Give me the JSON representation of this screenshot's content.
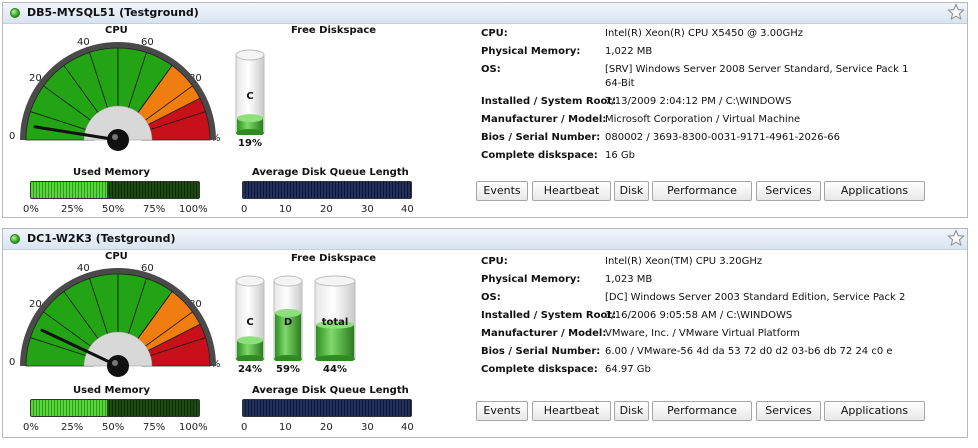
{
  "servers": [
    {
      "title": "DB5-MYSQL51 (Testground)",
      "cpu": {
        "label": "CPU",
        "percent": 5,
        "ticks": [
          "0",
          "20",
          "40",
          "60",
          "80",
          "%"
        ]
      },
      "diskspace": {
        "label": "Free Diskspace",
        "drives": [
          {
            "name": "C",
            "free_percent_label": "19%",
            "free_fraction": 0.19
          }
        ]
      },
      "used_memory": {
        "label": "Used Memory",
        "percent": 45,
        "ticks": [
          "0%",
          "25%",
          "50%",
          "75%",
          "100%"
        ]
      },
      "disk_queue": {
        "label": "Average Disk Queue Length",
        "value": 0,
        "max": 40,
        "ticks": [
          "0",
          "10",
          "20",
          "30",
          "40"
        ]
      },
      "info": [
        {
          "key": "CPU:",
          "value": "Intel(R) Xeon(R) CPU X5450 @ 3.00GHz"
        },
        {
          "key": "Physical Memory:",
          "value": "1,022 MB"
        },
        {
          "key": "OS:",
          "value": "[SRV] Windows Server 2008 Server Standard, Service Pack 1",
          "value2": "64-Bit"
        },
        {
          "key": "Installed / System Root:",
          "value": "7/13/2009 2:04:12 PM / C:\\WINDOWS"
        },
        {
          "key": "Manufacturer / Model:",
          "value": "Microsoft Corporation / Virtual Machine"
        },
        {
          "key": "Bios / Serial Number:",
          "value": "080002 / 3693-8300-0031-9171-4961-2026-66"
        },
        {
          "key": "Complete diskspace:",
          "value": "16 Gb"
        }
      ],
      "buttons": [
        "Events",
        "Heartbeat",
        "Disk",
        "Performance",
        "Services",
        "Applications"
      ]
    },
    {
      "title": "DC1-W2K3 (Testground)",
      "cpu": {
        "label": "CPU",
        "percent": 14,
        "ticks": [
          "0",
          "20",
          "40",
          "60",
          "80",
          "%"
        ]
      },
      "diskspace": {
        "label": "Free Diskspace",
        "drives": [
          {
            "name": "C",
            "free_percent_label": "24%",
            "free_fraction": 0.24
          },
          {
            "name": "D",
            "free_percent_label": "59%",
            "free_fraction": 0.59
          },
          {
            "name": "total",
            "free_percent_label": "44%",
            "free_fraction": 0.44
          }
        ]
      },
      "used_memory": {
        "label": "Used Memory",
        "percent": 45,
        "ticks": [
          "0%",
          "25%",
          "50%",
          "75%",
          "100%"
        ]
      },
      "disk_queue": {
        "label": "Average Disk Queue Length",
        "value": 0,
        "max": 40,
        "ticks": [
          "0",
          "10",
          "20",
          "30",
          "40"
        ]
      },
      "info": [
        {
          "key": "CPU:",
          "value": "Intel(R) Xeon(TM) CPU 3.20GHz"
        },
        {
          "key": "Physical Memory:",
          "value": "1,023 MB"
        },
        {
          "key": "OS:",
          "value": "[DC] Windows Server 2003 Standard Edition, Service Pack 2"
        },
        {
          "key": "Installed / System Root:",
          "value": "1/16/2006 9:05:58 AM / C:\\WINDOWS"
        },
        {
          "key": "Manufacturer / Model:",
          "value": "VMware, Inc. / VMware Virtual Platform"
        },
        {
          "key": "Bios / Serial Number:",
          "value": "6.00 / VMware-56 4d da 53 72 d0 d2 03-b6 db 72 24 c0 e"
        },
        {
          "key": "Complete diskspace:",
          "value": "64.97 Gb"
        }
      ],
      "buttons": [
        "Events",
        "Heartbeat",
        "Disk",
        "Performance",
        "Services",
        "Applications"
      ]
    }
  ],
  "colors": {
    "gauge_green": "#22a414",
    "gauge_orange": "#f07d10",
    "gauge_red": "#c8101a",
    "memory_green": "#3fbf2a",
    "queue_navy": "#0c1638",
    "header_blue": "#d9e4f1"
  }
}
